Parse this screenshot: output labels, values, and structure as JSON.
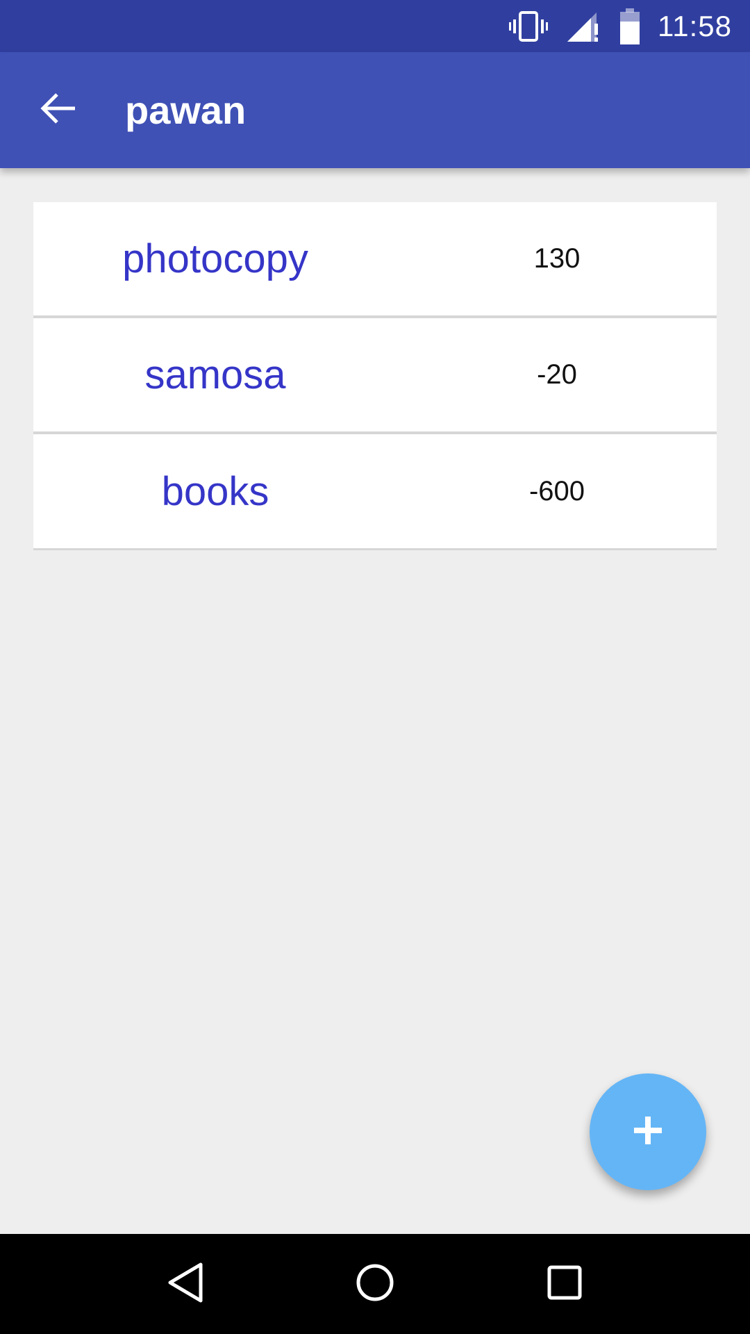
{
  "status_bar": {
    "time": "11:58",
    "icons": [
      "vibrate-icon",
      "signal-icon",
      "battery-icon"
    ]
  },
  "app_bar": {
    "title": "pawan",
    "back_icon": "arrow-back-icon"
  },
  "items": [
    {
      "name": "photocopy",
      "amount": "130"
    },
    {
      "name": "samosa",
      "amount": "-20"
    },
    {
      "name": "books",
      "amount": "-600"
    }
  ],
  "fab": {
    "icon": "plus-icon"
  },
  "nav_bar": {
    "icons": [
      "back-triangle-icon",
      "home-circle-icon",
      "recents-square-icon"
    ]
  },
  "colors": {
    "status_bar": "#303f9f",
    "app_bar": "#3f51b5",
    "item_name": "#3535c8",
    "fab": "#64b5f6",
    "background": "#eeeeee"
  }
}
